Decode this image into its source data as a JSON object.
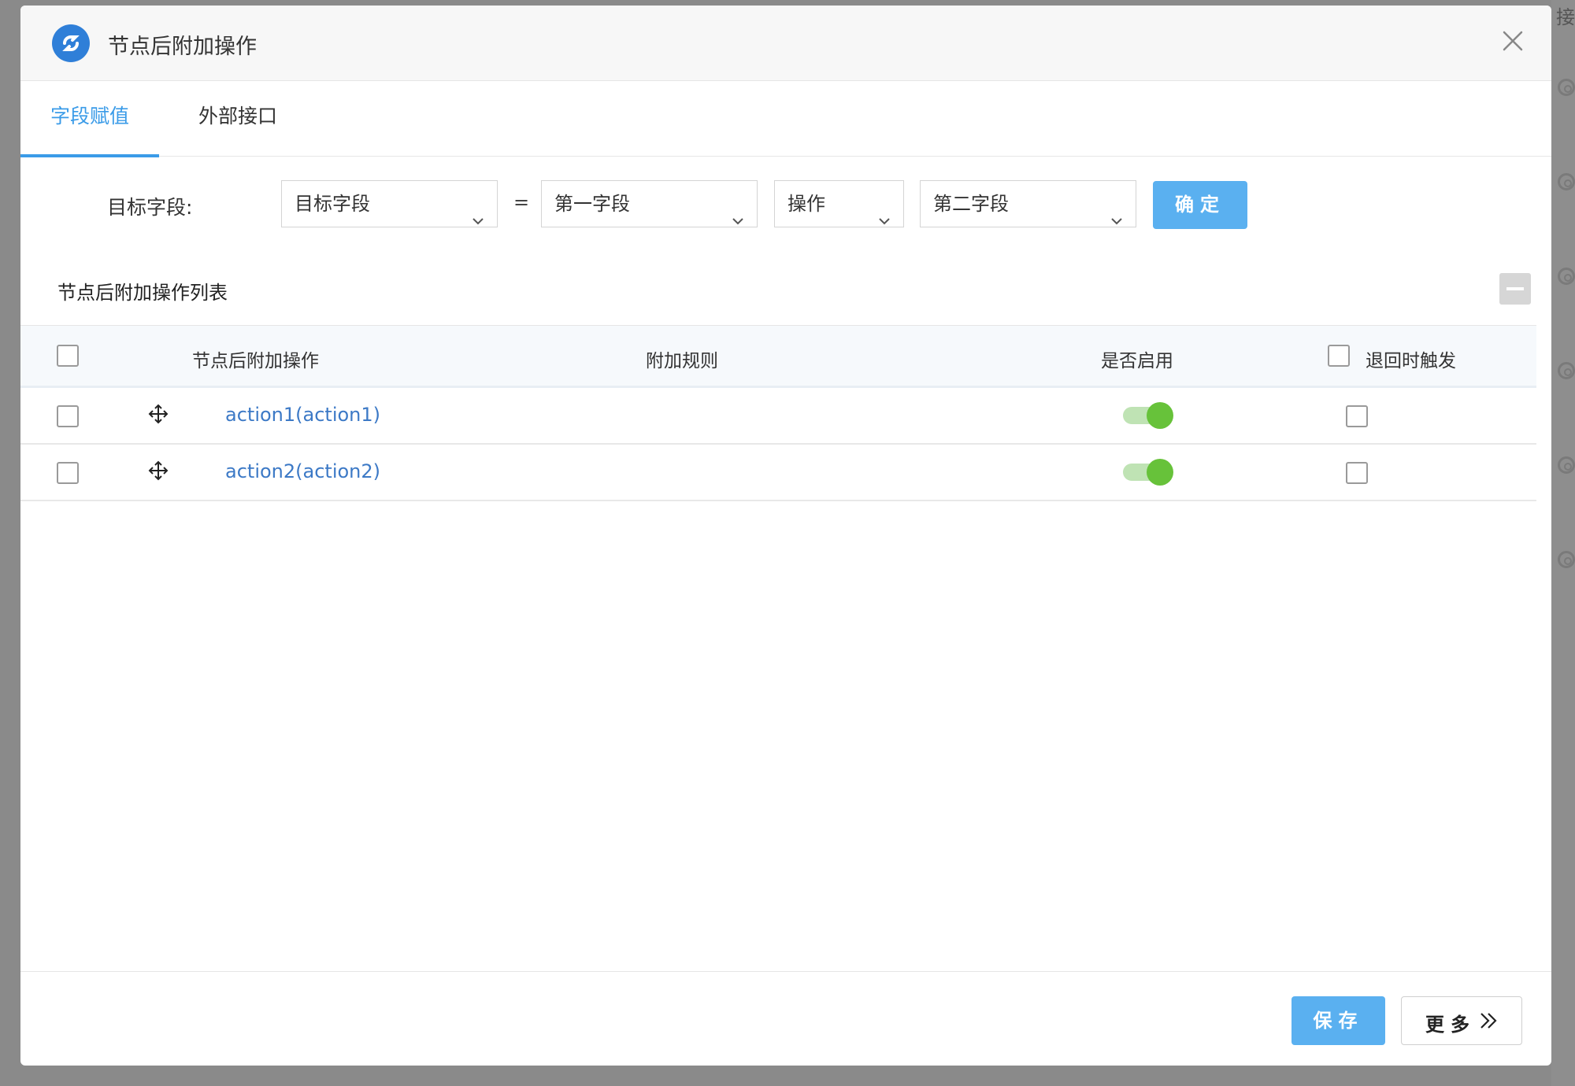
{
  "dialog": {
    "title": "节点后附加操作",
    "close_icon": "close-icon",
    "logo_icon": "app-logo-icon"
  },
  "background": {
    "edge_char": "接"
  },
  "tabs": [
    {
      "label": "字段赋值",
      "active": true
    },
    {
      "label": "外部接口",
      "active": false
    }
  ],
  "form": {
    "target_label": "目标字段:",
    "target_select": "目标字段",
    "equals": "=",
    "first_select": "第一字段",
    "op_select": "操作",
    "second_select": "第二字段",
    "confirm_label": "确定"
  },
  "list": {
    "title": "节点后附加操作列表",
    "columns": {
      "action": "节点后附加操作",
      "rule": "附加规则",
      "enabled": "是否启用",
      "rollback": "退回时触发"
    },
    "rows": [
      {
        "action": "action1(action1)",
        "rule": "",
        "enabled": true,
        "rollback": false
      },
      {
        "action": "action2(action2)",
        "rule": "",
        "enabled": true,
        "rollback": false
      }
    ]
  },
  "footer": {
    "save_label": "保存",
    "more_label": "更多",
    "more_icon": "double-chevron-right-icon"
  },
  "colors": {
    "accent": "#3a9be8",
    "primary_button": "#5ab0f0",
    "toggle_on": "#67c23a",
    "link": "#3c79c6"
  }
}
